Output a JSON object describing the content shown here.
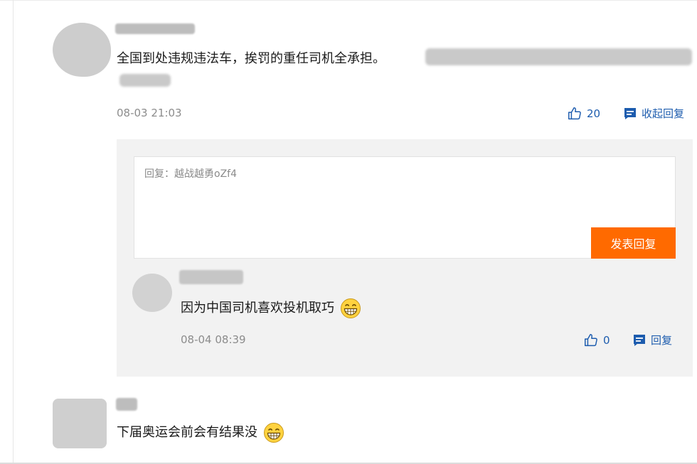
{
  "comments": [
    {
      "text": "全国到处违规违法车，挨罚的重任司机全承担。",
      "time": "08-03 21:03",
      "likes": "20",
      "reply_action": "收起回复"
    },
    {
      "text": "下届奥运会前会有结果没"
    }
  ],
  "reply_box": {
    "placeholder": "回复：越战越勇oZf4",
    "submit_label": "发表回复"
  },
  "sub_reply": {
    "text": "因为中国司机喜欢投机取巧",
    "time": "08-04 08:39",
    "likes": "0",
    "reply_action": "回复"
  },
  "colors": {
    "accent": "#ff6a00",
    "link": "#1d5cae"
  },
  "icons": [
    "thumb-up-icon",
    "comment-icon",
    "grin-emoji-icon"
  ]
}
